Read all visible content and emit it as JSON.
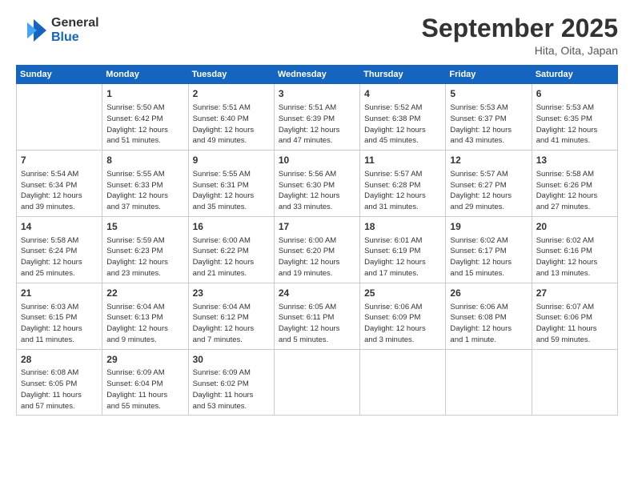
{
  "header": {
    "logo_general": "General",
    "logo_blue": "Blue",
    "month_title": "September 2025",
    "location": "Hita, Oita, Japan"
  },
  "days_of_week": [
    "Sunday",
    "Monday",
    "Tuesday",
    "Wednesday",
    "Thursday",
    "Friday",
    "Saturday"
  ],
  "weeks": [
    [
      {
        "day": "",
        "info": ""
      },
      {
        "day": "1",
        "info": "Sunrise: 5:50 AM\nSunset: 6:42 PM\nDaylight: 12 hours\nand 51 minutes."
      },
      {
        "day": "2",
        "info": "Sunrise: 5:51 AM\nSunset: 6:40 PM\nDaylight: 12 hours\nand 49 minutes."
      },
      {
        "day": "3",
        "info": "Sunrise: 5:51 AM\nSunset: 6:39 PM\nDaylight: 12 hours\nand 47 minutes."
      },
      {
        "day": "4",
        "info": "Sunrise: 5:52 AM\nSunset: 6:38 PM\nDaylight: 12 hours\nand 45 minutes."
      },
      {
        "day": "5",
        "info": "Sunrise: 5:53 AM\nSunset: 6:37 PM\nDaylight: 12 hours\nand 43 minutes."
      },
      {
        "day": "6",
        "info": "Sunrise: 5:53 AM\nSunset: 6:35 PM\nDaylight: 12 hours\nand 41 minutes."
      }
    ],
    [
      {
        "day": "7",
        "info": "Sunrise: 5:54 AM\nSunset: 6:34 PM\nDaylight: 12 hours\nand 39 minutes."
      },
      {
        "day": "8",
        "info": "Sunrise: 5:55 AM\nSunset: 6:33 PM\nDaylight: 12 hours\nand 37 minutes."
      },
      {
        "day": "9",
        "info": "Sunrise: 5:55 AM\nSunset: 6:31 PM\nDaylight: 12 hours\nand 35 minutes."
      },
      {
        "day": "10",
        "info": "Sunrise: 5:56 AM\nSunset: 6:30 PM\nDaylight: 12 hours\nand 33 minutes."
      },
      {
        "day": "11",
        "info": "Sunrise: 5:57 AM\nSunset: 6:28 PM\nDaylight: 12 hours\nand 31 minutes."
      },
      {
        "day": "12",
        "info": "Sunrise: 5:57 AM\nSunset: 6:27 PM\nDaylight: 12 hours\nand 29 minutes."
      },
      {
        "day": "13",
        "info": "Sunrise: 5:58 AM\nSunset: 6:26 PM\nDaylight: 12 hours\nand 27 minutes."
      }
    ],
    [
      {
        "day": "14",
        "info": "Sunrise: 5:58 AM\nSunset: 6:24 PM\nDaylight: 12 hours\nand 25 minutes."
      },
      {
        "day": "15",
        "info": "Sunrise: 5:59 AM\nSunset: 6:23 PM\nDaylight: 12 hours\nand 23 minutes."
      },
      {
        "day": "16",
        "info": "Sunrise: 6:00 AM\nSunset: 6:22 PM\nDaylight: 12 hours\nand 21 minutes."
      },
      {
        "day": "17",
        "info": "Sunrise: 6:00 AM\nSunset: 6:20 PM\nDaylight: 12 hours\nand 19 minutes."
      },
      {
        "day": "18",
        "info": "Sunrise: 6:01 AM\nSunset: 6:19 PM\nDaylight: 12 hours\nand 17 minutes."
      },
      {
        "day": "19",
        "info": "Sunrise: 6:02 AM\nSunset: 6:17 PM\nDaylight: 12 hours\nand 15 minutes."
      },
      {
        "day": "20",
        "info": "Sunrise: 6:02 AM\nSunset: 6:16 PM\nDaylight: 12 hours\nand 13 minutes."
      }
    ],
    [
      {
        "day": "21",
        "info": "Sunrise: 6:03 AM\nSunset: 6:15 PM\nDaylight: 12 hours\nand 11 minutes."
      },
      {
        "day": "22",
        "info": "Sunrise: 6:04 AM\nSunset: 6:13 PM\nDaylight: 12 hours\nand 9 minutes."
      },
      {
        "day": "23",
        "info": "Sunrise: 6:04 AM\nSunset: 6:12 PM\nDaylight: 12 hours\nand 7 minutes."
      },
      {
        "day": "24",
        "info": "Sunrise: 6:05 AM\nSunset: 6:11 PM\nDaylight: 12 hours\nand 5 minutes."
      },
      {
        "day": "25",
        "info": "Sunrise: 6:06 AM\nSunset: 6:09 PM\nDaylight: 12 hours\nand 3 minutes."
      },
      {
        "day": "26",
        "info": "Sunrise: 6:06 AM\nSunset: 6:08 PM\nDaylight: 12 hours\nand 1 minute."
      },
      {
        "day": "27",
        "info": "Sunrise: 6:07 AM\nSunset: 6:06 PM\nDaylight: 11 hours\nand 59 minutes."
      }
    ],
    [
      {
        "day": "28",
        "info": "Sunrise: 6:08 AM\nSunset: 6:05 PM\nDaylight: 11 hours\nand 57 minutes."
      },
      {
        "day": "29",
        "info": "Sunrise: 6:09 AM\nSunset: 6:04 PM\nDaylight: 11 hours\nand 55 minutes."
      },
      {
        "day": "30",
        "info": "Sunrise: 6:09 AM\nSunset: 6:02 PM\nDaylight: 11 hours\nand 53 minutes."
      },
      {
        "day": "",
        "info": ""
      },
      {
        "day": "",
        "info": ""
      },
      {
        "day": "",
        "info": ""
      },
      {
        "day": "",
        "info": ""
      }
    ]
  ]
}
